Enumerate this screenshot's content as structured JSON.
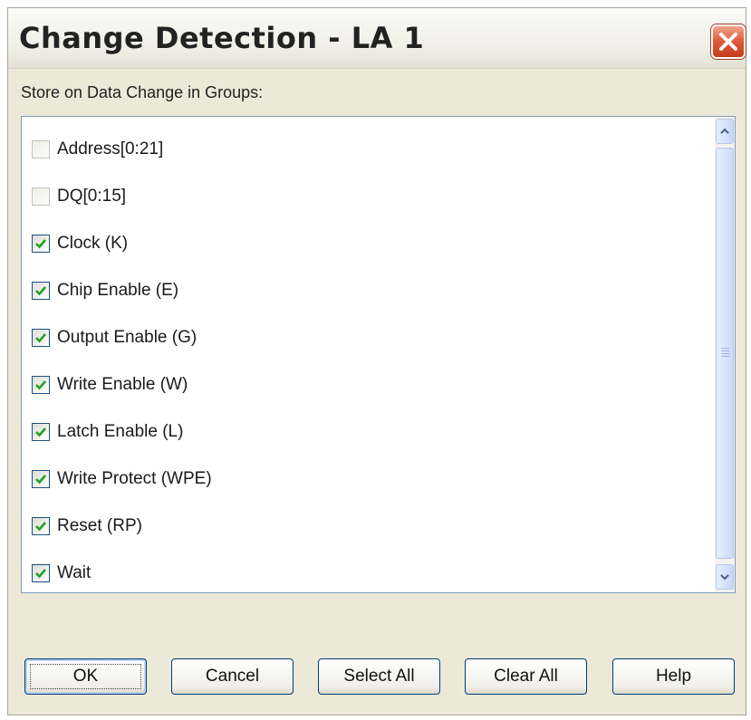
{
  "window": {
    "title": "Change Detection - LA 1"
  },
  "group_label": "Store on Data Change in Groups:",
  "items": [
    {
      "label": "Address[0:21]",
      "checked": false
    },
    {
      "label": "DQ[0:15]",
      "checked": false
    },
    {
      "label": "Clock (K)",
      "checked": true
    },
    {
      "label": "Chip Enable (E)",
      "checked": true
    },
    {
      "label": "Output Enable (G)",
      "checked": true
    },
    {
      "label": "Write Enable (W)",
      "checked": true
    },
    {
      "label": "Latch Enable (L)",
      "checked": true
    },
    {
      "label": "Write Protect (WPE)",
      "checked": true
    },
    {
      "label": "Reset (RP)",
      "checked": true
    },
    {
      "label": "Wait",
      "checked": true
    }
  ],
  "buttons": {
    "ok": "OK",
    "cancel": "Cancel",
    "select_all": "Select All",
    "clear_all": "Clear All",
    "help": "Help"
  },
  "colors": {
    "check": "#21a121",
    "close": "#dd5a3a",
    "border": "#7f9db9"
  }
}
